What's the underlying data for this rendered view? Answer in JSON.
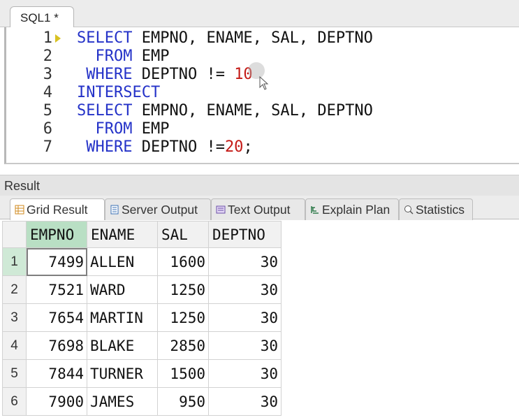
{
  "editor_tab": {
    "label": "SQL1 *"
  },
  "editor": {
    "lines": [
      {
        "n": "1",
        "tokens": [
          {
            "t": "kw",
            "v": "SELECT"
          },
          {
            "t": "tx",
            "v": " EMPNO, ENAME, SAL, DEPTNO"
          }
        ]
      },
      {
        "n": "2",
        "tokens": [
          {
            "t": "tx",
            "v": "  "
          },
          {
            "t": "kw",
            "v": "FROM"
          },
          {
            "t": "tx",
            "v": " EMP"
          }
        ]
      },
      {
        "n": "3",
        "tokens": [
          {
            "t": "tx",
            "v": " "
          },
          {
            "t": "kw",
            "v": "WHERE"
          },
          {
            "t": "tx",
            "v": " DEPTNO != "
          },
          {
            "t": "num",
            "v": "10"
          }
        ]
      },
      {
        "n": "4",
        "tokens": [
          {
            "t": "kw",
            "v": "INTERSECT"
          }
        ]
      },
      {
        "n": "5",
        "tokens": [
          {
            "t": "kw",
            "v": "SELECT"
          },
          {
            "t": "tx",
            "v": " EMPNO, ENAME, SAL, DEPTNO"
          }
        ]
      },
      {
        "n": "6",
        "tokens": [
          {
            "t": "tx",
            "v": "  "
          },
          {
            "t": "kw",
            "v": "FROM"
          },
          {
            "t": "tx",
            "v": " EMP"
          }
        ]
      },
      {
        "n": "7",
        "tokens": [
          {
            "t": "tx",
            "v": " "
          },
          {
            "t": "kw",
            "v": "WHERE"
          },
          {
            "t": "tx",
            "v": " DEPTNO !="
          },
          {
            "t": "num",
            "v": "20"
          },
          {
            "t": "tx",
            "v": ";"
          }
        ]
      }
    ]
  },
  "result": {
    "title": "Result",
    "tabs": [
      {
        "label": "Grid Result",
        "icon": "grid-icon",
        "active": true
      },
      {
        "label": "Server Output",
        "icon": "server-output-icon",
        "active": false
      },
      {
        "label": "Text Output",
        "icon": "text-output-icon",
        "active": false
      },
      {
        "label": "Explain Plan",
        "icon": "explain-plan-icon",
        "active": false
      },
      {
        "label": "Statistics",
        "icon": "statistics-icon",
        "active": false
      }
    ],
    "columns": [
      "EMPNO",
      "ENAME",
      "SAL",
      "DEPTNO"
    ],
    "rows": [
      {
        "n": "1",
        "cells": [
          "7499",
          "ALLEN",
          "1600",
          "30"
        ]
      },
      {
        "n": "2",
        "cells": [
          "7521",
          "WARD",
          "1250",
          "30"
        ]
      },
      {
        "n": "3",
        "cells": [
          "7654",
          "MARTIN",
          "1250",
          "30"
        ]
      },
      {
        "n": "4",
        "cells": [
          "7698",
          "BLAKE",
          "2850",
          "30"
        ]
      },
      {
        "n": "5",
        "cells": [
          "7844",
          "TURNER",
          "1500",
          "30"
        ]
      },
      {
        "n": "6",
        "cells": [
          "7900",
          "JAMES",
          "950",
          "30"
        ]
      }
    ]
  },
  "colors": {
    "keyword": "#2432c8",
    "number": "#c41a16",
    "selected_header": "#b9dfc4"
  }
}
